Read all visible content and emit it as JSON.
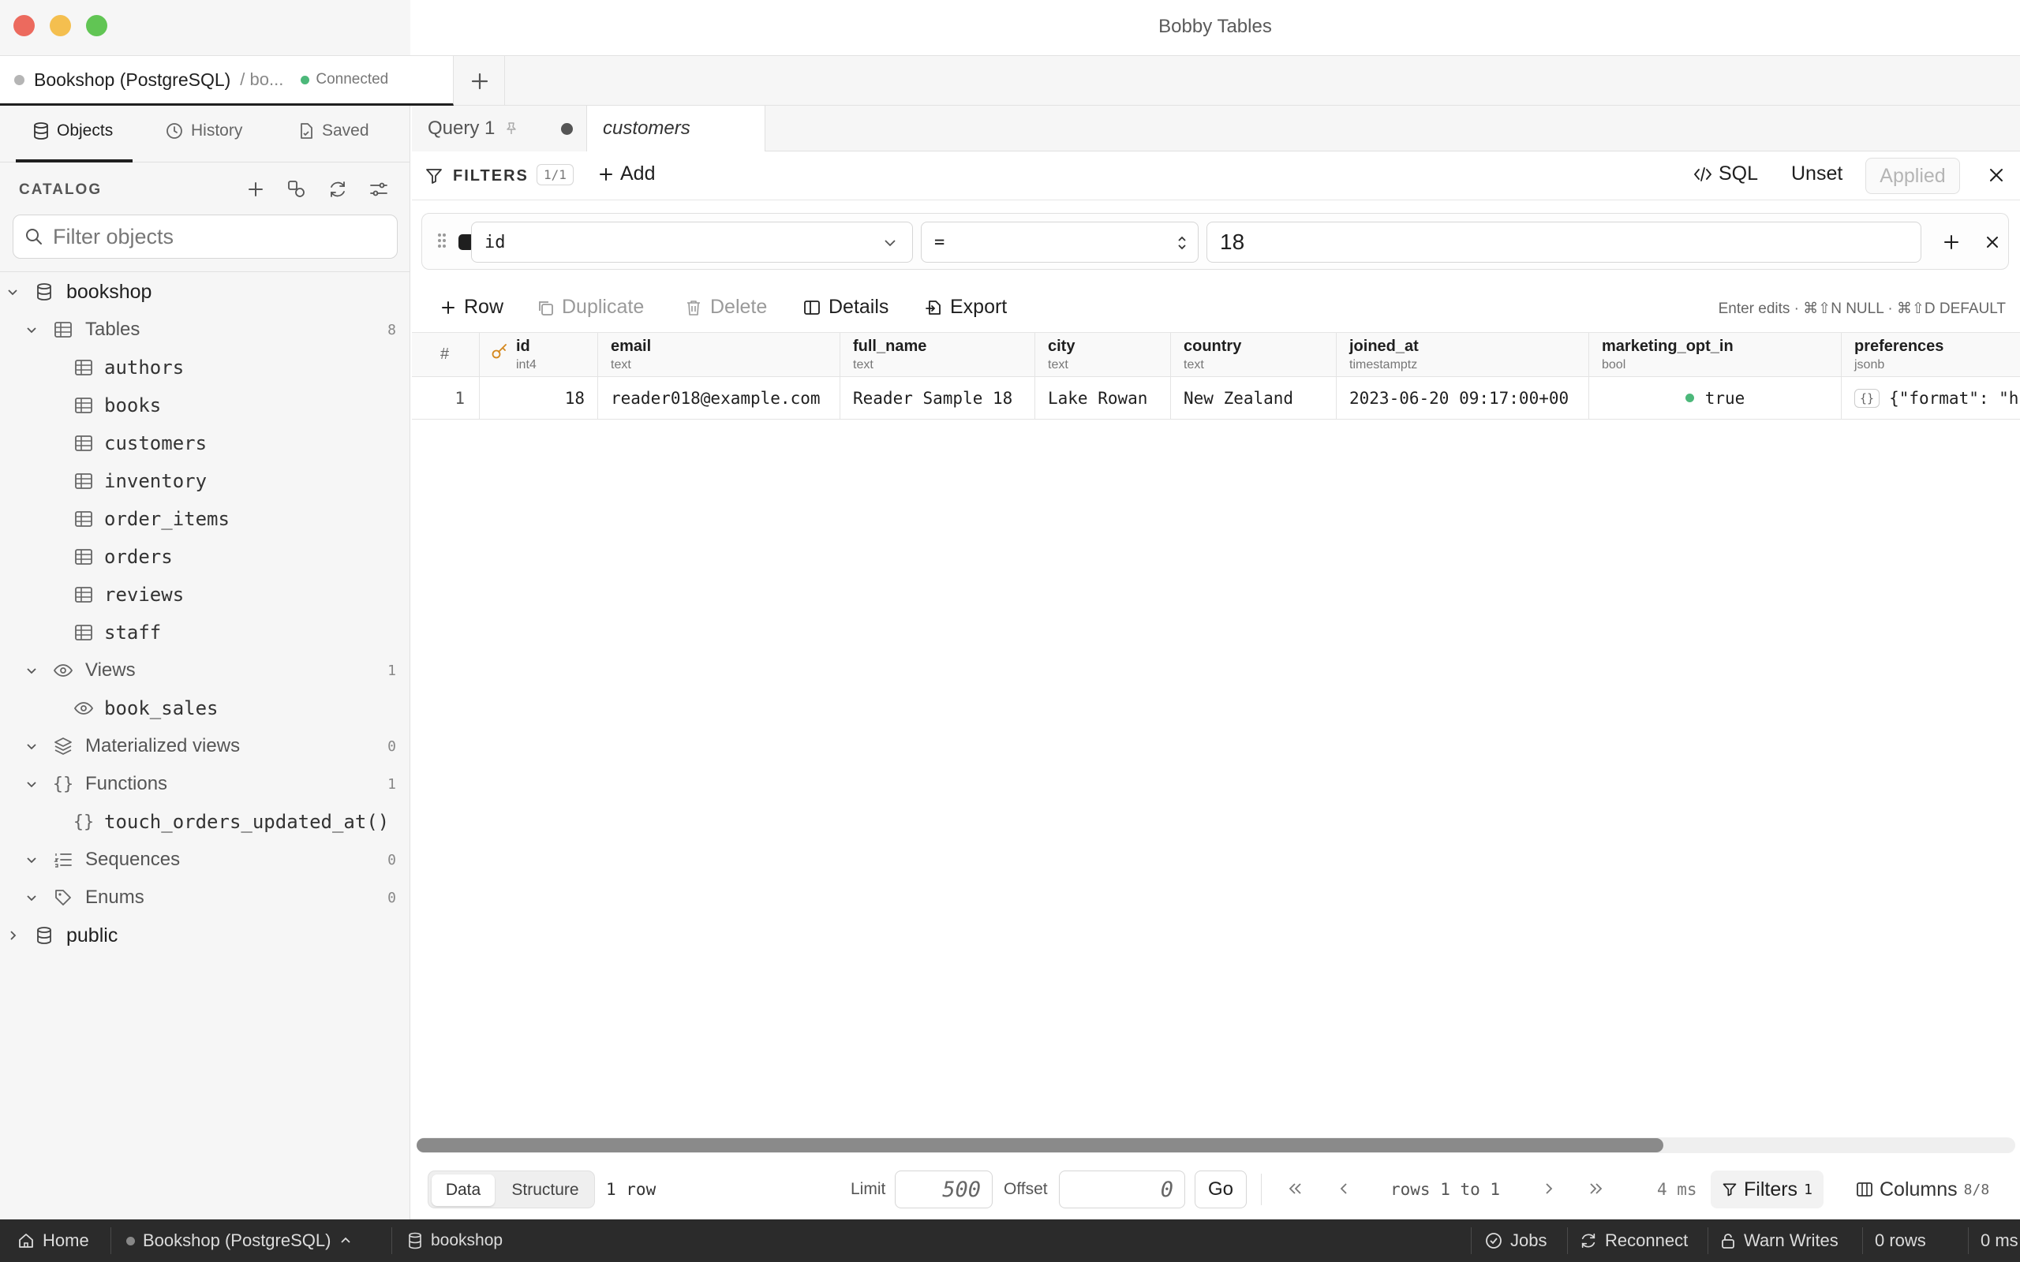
{
  "window": {
    "title": "Bobby Tables"
  },
  "connection_tab": {
    "name": "Bookshop (PostgreSQL)",
    "schema": "/ bo...",
    "status": "Connected",
    "status_color": "#4cb87a"
  },
  "sidebar": {
    "tabs": [
      {
        "label": "Objects"
      },
      {
        "label": "History"
      },
      {
        "label": "Saved"
      }
    ],
    "catalog_label": "CATALOG",
    "filter_placeholder": "Filter objects",
    "tree": {
      "db": "bookshop",
      "groups": {
        "tables": {
          "label": "Tables",
          "count": "8",
          "items": [
            "authors",
            "books",
            "customers",
            "inventory",
            "order_items",
            "orders",
            "reviews",
            "staff"
          ]
        },
        "views": {
          "label": "Views",
          "count": "1",
          "items": [
            "book_sales"
          ]
        },
        "matviews": {
          "label": "Materialized views",
          "count": "0"
        },
        "functions": {
          "label": "Functions",
          "count": "1",
          "items": [
            "touch_orders_updated_at()"
          ]
        },
        "sequences": {
          "label": "Sequences",
          "count": "0"
        },
        "enums": {
          "label": "Enums",
          "count": "0"
        }
      },
      "public": "public"
    }
  },
  "query_tabs": [
    {
      "label": "Query 1"
    },
    {
      "label": "customers"
    }
  ],
  "filters": {
    "label": "FILTERS",
    "count": "1/1",
    "add_label": "Add",
    "sql_label": "SQL",
    "unset_label": "Unset",
    "applied_label": "Applied",
    "row": {
      "column": "id",
      "operator": "=",
      "value": "18"
    }
  },
  "toolbar": {
    "row_label": "Row",
    "duplicate_label": "Duplicate",
    "delete_label": "Delete",
    "details_label": "Details",
    "export_label": "Export",
    "hint": "Enter edits · ⌘⇧N NULL · ⌘⇧D DEFAULT"
  },
  "grid": {
    "rownum_header": "#",
    "columns": [
      {
        "name": "id",
        "type": "int4"
      },
      {
        "name": "email",
        "type": "text"
      },
      {
        "name": "full_name",
        "type": "text"
      },
      {
        "name": "city",
        "type": "text"
      },
      {
        "name": "country",
        "type": "text"
      },
      {
        "name": "joined_at",
        "type": "timestamptz"
      },
      {
        "name": "marketing_opt_in",
        "type": "bool"
      },
      {
        "name": "preferences",
        "type": "jsonb"
      }
    ],
    "rows": [
      {
        "num": "1",
        "cells": [
          "18",
          "reader018@example.com",
          "Reader Sample 18",
          "Lake Rowan",
          "New Zealand",
          "2023-06-20 09:17:00+00",
          "true",
          "{\"format\": \"h"
        ]
      }
    ],
    "json_badge": "{}"
  },
  "pager": {
    "mode_data": "Data",
    "mode_structure": "Structure",
    "row_count": "1 row",
    "limit_label": "Limit",
    "limit_value": "500",
    "offset_label": "Offset",
    "offset_value": "0",
    "go_label": "Go",
    "range_text": "rows 1 to 1",
    "timing": "4 ms",
    "filters_label": "Filters",
    "filters_count": "1",
    "columns_label": "Columns",
    "columns_count": "8/8"
  },
  "statusbar": {
    "home": "Home",
    "connection": "Bookshop (PostgreSQL)",
    "database": "bookshop",
    "jobs": "Jobs",
    "reconnect": "Reconnect",
    "warn_writes": "Warn Writes",
    "rows": "0 rows",
    "time": "0 ms"
  }
}
